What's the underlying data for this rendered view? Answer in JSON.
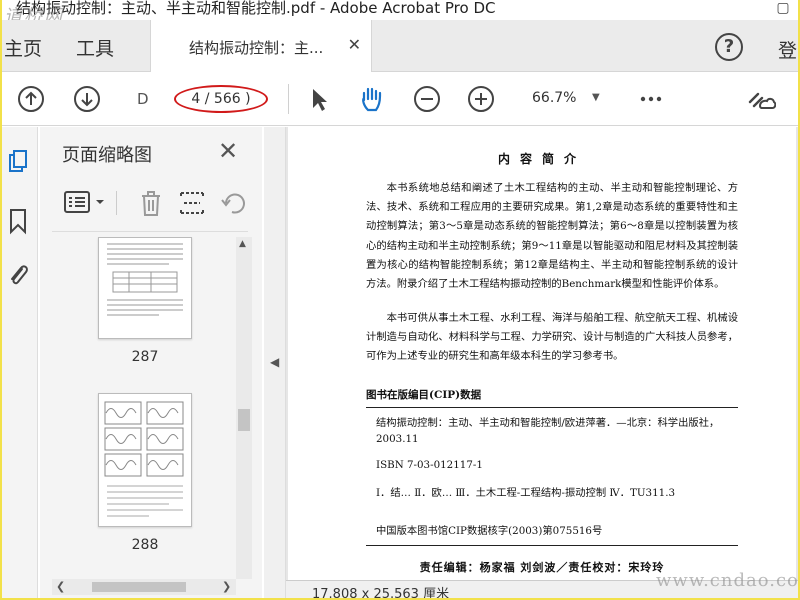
{
  "window": {
    "title": "结构振动控制：主动、半主动和智能控制.pdf - Adobe Acrobat Pro DC"
  },
  "watermarks": {
    "top_left": "道桥网",
    "bottom_right": "www.cndao.com"
  },
  "tabs": {
    "home": "主页",
    "tools": "工具",
    "doc": "结构振动控制：主...",
    "signin": "登"
  },
  "toolbar": {
    "page_field": "D",
    "page_count": "4 / 566 )",
    "zoom": "66.7%"
  },
  "thumbnail_panel": {
    "title": "页面缩略图",
    "pages": [
      "287",
      "288"
    ]
  },
  "document": {
    "heading": "内容简介",
    "intro_1": "本书系统地总结和阐述了土木工程结构的主动、半主动和智能控制理论、方法、技术、系统和工程应用的主要研究成果。第1,2章是动态系统的重要特性和主动控制算法；第3～5章是动态系统的智能控制算法；第6～8章是以控制装置为核心的结构主动和半主动控制系统；第9～11章是以智能驱动和阻尼材料及其控制装置为核心的结构智能控制系统；第12章是结构主、半主动和智能控制系统的设计方法。附录介绍了土木工程结构振动控制的Benchmark模型和性能评价体系。",
    "intro_2": "本书可供从事土木工程、水利工程、海洋与船舶工程、航空航天工程、机械设计制造与自动化、材料科学与工程、力学研究、设计与制造的广大科技人员参考，可作为上述专业的研究生和高年级本科生的学习参考书。",
    "cip_title": "图书在版编目(CIP)数据",
    "cip_entry": "结构振动控制：主动、半主动和智能控制/欧进萍著．—北京：科学出版社，2003.11",
    "isbn": "ISBN 7-03-012117-1",
    "classification": "Ⅰ．结…  Ⅱ．欧…  Ⅲ．土木工程-工程结构-振动控制  Ⅳ．TU311.3",
    "cip_number": "中国版本图书馆CIP数据核字(2003)第075516号",
    "editors": "责任编辑：杨家福  刘剑波／责任校对：宋玲玲"
  },
  "status": {
    "dimensions": "17.808 x 25.563 厘米"
  }
}
